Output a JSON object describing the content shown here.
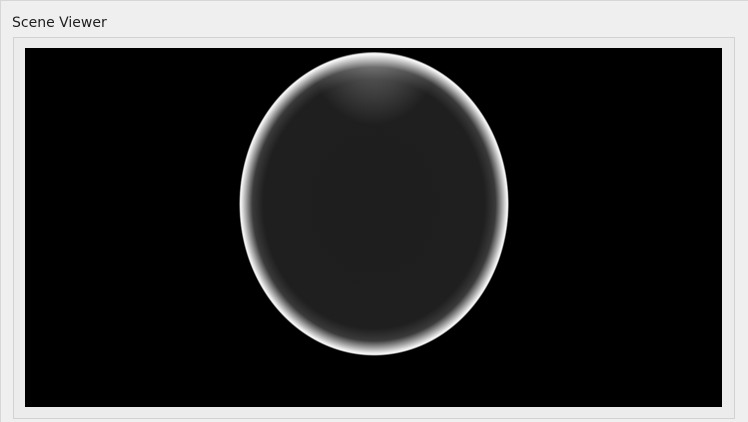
{
  "window": {
    "group_title": "Scene Viewer"
  },
  "viewport": {
    "background_color": "#000000",
    "object": {
      "type": "sphere",
      "fill_color": "#1e1e1e",
      "rim_color": "#ffffff"
    }
  }
}
